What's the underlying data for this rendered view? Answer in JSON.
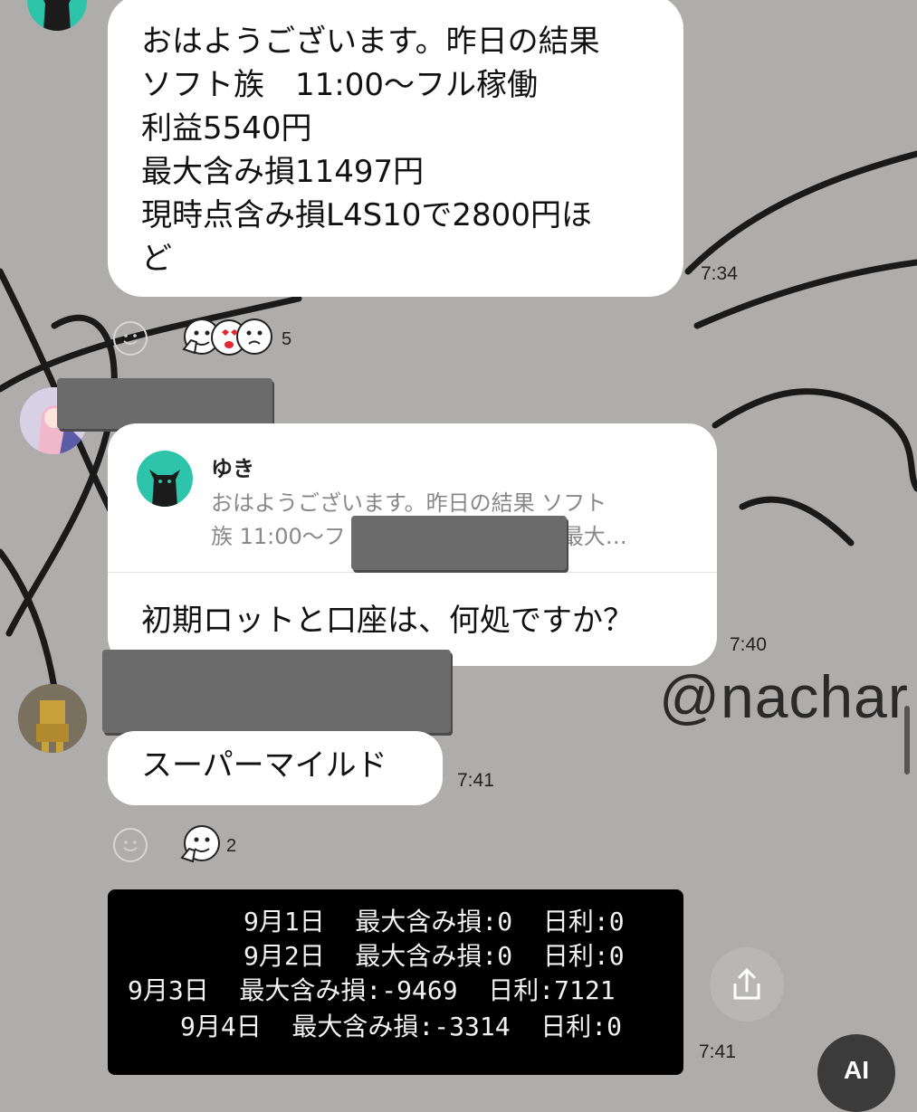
{
  "messages": [
    {
      "text": "おはようございます。昨日の結果\nソフト族　11:00〜フル稼働\n利益5540円\n最大含み損11497円\n現時点含み損L4S10で2800円ほ\nど",
      "time": "7:34",
      "reaction_count": "5"
    },
    {
      "reply_to": {
        "name": "ゆき",
        "preview": "おはようございます。昨日の結果 ソフト\n族 11:00〜フ　　　　　　　　0円 最大…"
      },
      "text": "初期ロットと口座は、何処ですか？",
      "time": "7:40"
    },
    {
      "text": "スーパーマイルド",
      "time": "7:41",
      "reaction_count": "2"
    },
    {
      "image_lines": [
        "9月1日  最大含み損:0  日利:0",
        "9月2日  最大含み損:0  日利:0",
        "9月3日  最大含み損:-9469  日利:7121",
        "9月4日  最大含み損:-3314  日利:0"
      ],
      "time": "7:41"
    }
  ],
  "watermark": "@nachar",
  "ai_button": "AI",
  "colors": {
    "background": "#aeadab",
    "bubble": "#ffffff",
    "reply_avatar": "#2ec4a9"
  },
  "icons": {
    "reaction": "smiley-outline-icon",
    "share": "share-icon",
    "ai": "ai-icon"
  }
}
